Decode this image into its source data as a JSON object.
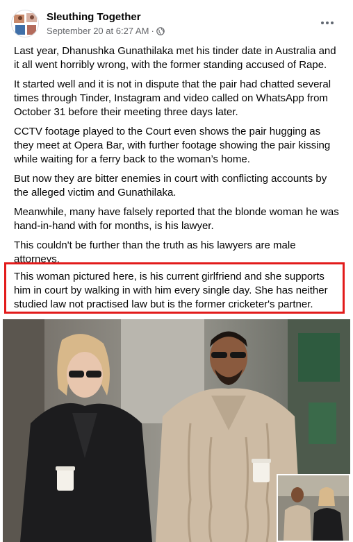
{
  "post": {
    "author": "Sleuthing Together",
    "timestamp": "September 20 at 6:27 AM",
    "separator": "·",
    "privacy_icon": "globe-icon",
    "more_icon": "more-options-icon"
  },
  "paragraphs": [
    "Last year, Dhanushka Gunathilaka met his tinder date in Australia and it all went horribly wrong, with the former standing accused of Rape.",
    "It started well and it is not in dispute that the pair had chatted several times through Tinder, Instagram and video called on WhatsApp from October 31 before their meeting three days later.",
    "CCTV footage played to the Court even shows the pair hugging as they meet at Opera Bar, with further footage showing the pair kissing while waiting for a ferry back to the woman’s home.",
    "But now they are bitter enemies in court with conflicting accounts by the alleged victim and Gunathilaka.",
    "Meanwhile, many have falsely reported that the blonde woman he was hand-in-hand with for months, is his lawyer.",
    "This couldn't be further than the truth as his lawyers are male attorneys."
  ],
  "highlighted_paragraph": "This woman pictured here, is his current girlfriend and she supports him in court by walking in with him every single day. She has neither studied law not practised law but is the former cricketer's partner.",
  "colors": {
    "highlight_border": "#e21b1b",
    "text": "#050505",
    "meta": "#65676b"
  }
}
